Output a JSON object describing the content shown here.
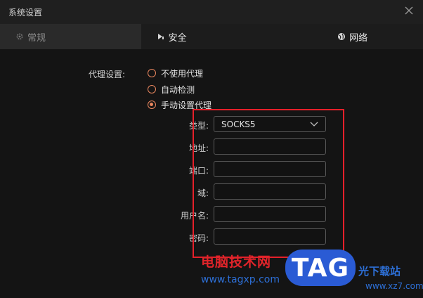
{
  "window": {
    "title": "系统设置"
  },
  "tabs": [
    {
      "label": "常规",
      "icon": "gear-icon"
    },
    {
      "label": "安全",
      "icon": "security-icon"
    },
    {
      "label": "网络",
      "icon": "globe-icon"
    }
  ],
  "proxy": {
    "section_label": "代理设置:",
    "options": [
      {
        "label": "不使用代理",
        "checked": false
      },
      {
        "label": "自动检测",
        "checked": false
      },
      {
        "label": "手动设置代理",
        "checked": true
      }
    ],
    "fields": [
      {
        "label": "类型:",
        "value": "SOCKS5",
        "kind": "select"
      },
      {
        "label": "地址:",
        "value": ""
      },
      {
        "label": "端口:",
        "value": ""
      },
      {
        "label": "域:",
        "value": ""
      },
      {
        "label": "用户名:",
        "value": ""
      },
      {
        "label": "密码:",
        "value": ""
      }
    ]
  },
  "colors": {
    "accent": "#e9865e",
    "highlight": "#e5202a"
  },
  "watermark": {
    "text": "电脑技术网",
    "url": "www.tagxp.com",
    "badge": "TAG",
    "site": "光下载站",
    "site_url": "www.xz7.com"
  }
}
